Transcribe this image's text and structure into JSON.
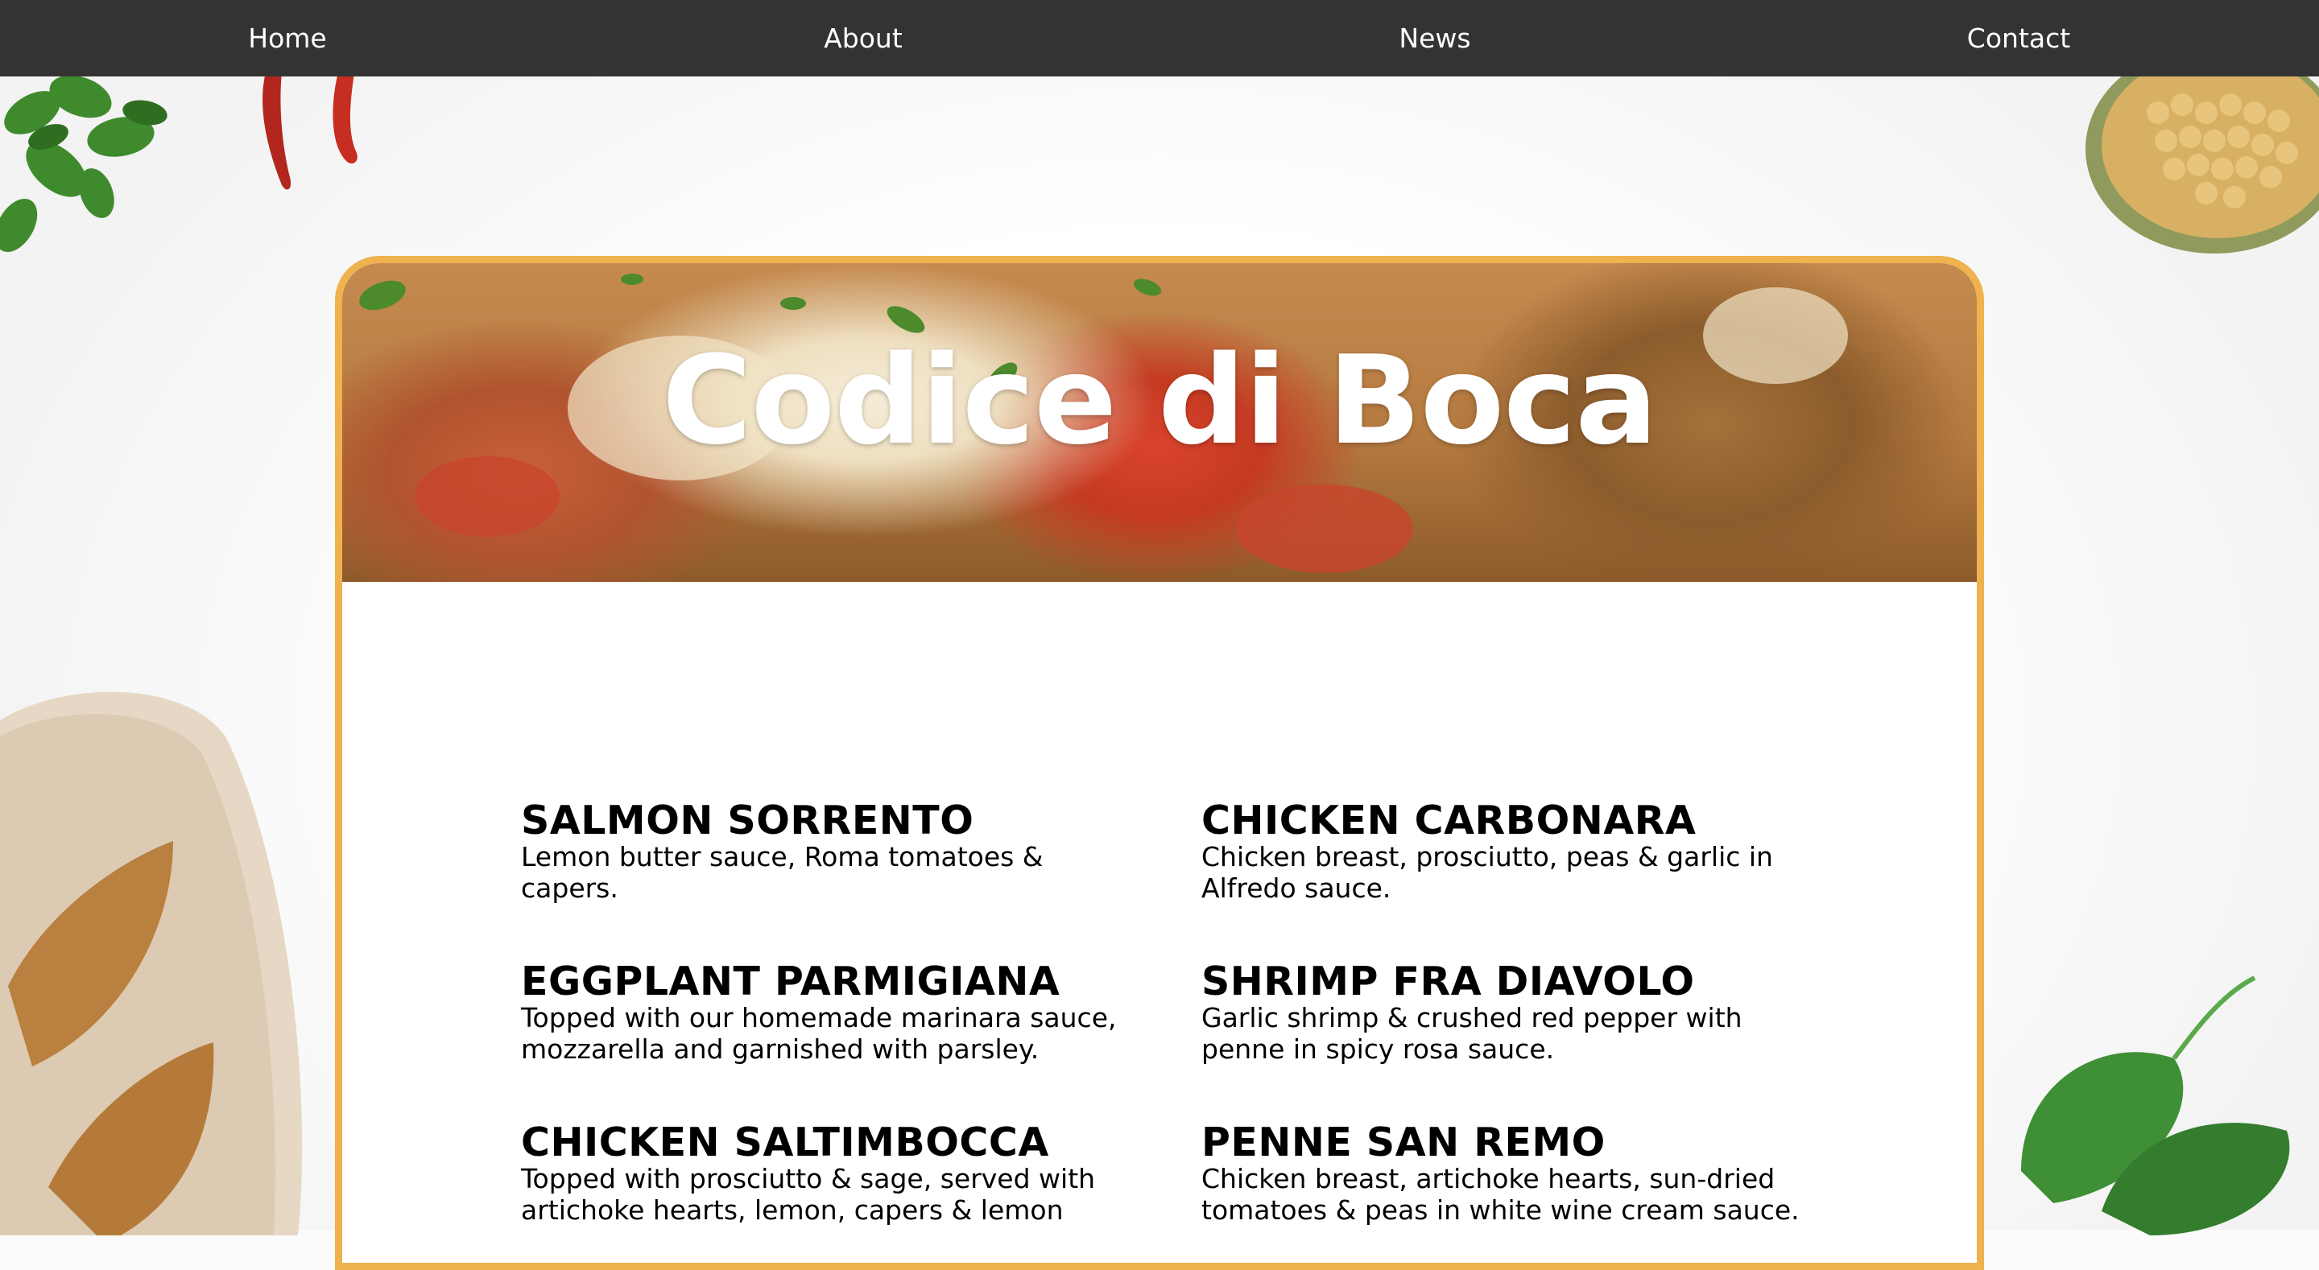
{
  "nav": {
    "items": [
      {
        "label": "Home"
      },
      {
        "label": "About"
      },
      {
        "label": "News"
      },
      {
        "label": "Contact"
      }
    ]
  },
  "hero": {
    "title": "Codice di Boca"
  },
  "menu": {
    "items": [
      {
        "name": "SALMON SORRENTO",
        "description": "Lemon butter sauce, Roma tomatoes & capers."
      },
      {
        "name": "CHICKEN CARBONARA",
        "description": "Chicken breast, prosciutto, peas & garlic in Alfredo sauce."
      },
      {
        "name": "EGGPLANT PARMIGIANA",
        "description": "Topped with our homemade marinara sauce, mozzarella and garnished with parsley."
      },
      {
        "name": "SHRIMP FRA DIAVOLO",
        "description": "Garlic shrimp & crushed red pepper with penne in spicy rosa sauce."
      },
      {
        "name": "CHICKEN SALTIMBOCCA",
        "description": "Topped with prosciutto & sage, served with artichoke hearts, lemon, capers & lemon"
      },
      {
        "name": "PENNE SAN REMO",
        "description": "Chicken breast, artichoke hearts, sun-dried tomatoes & peas in white wine cream sauce."
      }
    ]
  },
  "colors": {
    "nav_bg": "#333333",
    "card_border": "#f0b14f",
    "text": "#000000"
  }
}
